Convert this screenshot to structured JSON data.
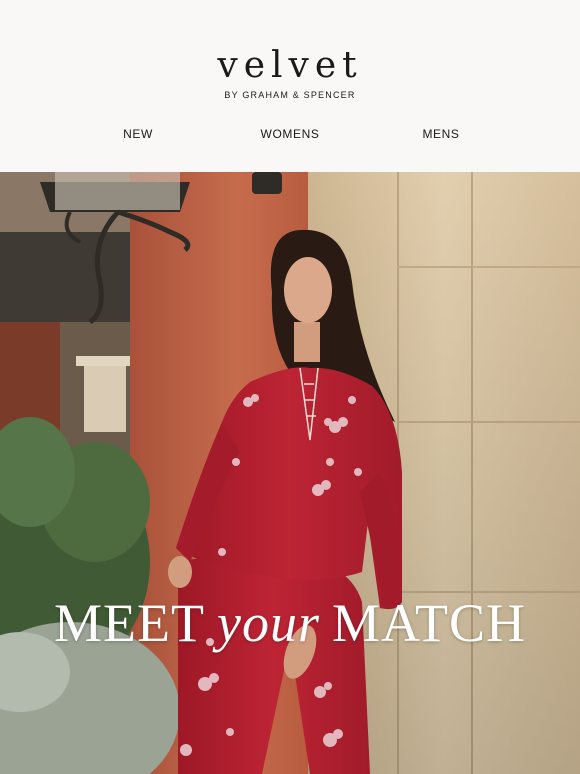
{
  "brand": {
    "logo_text": "velvet",
    "tagline": "BY GRAHAM & SPENCER"
  },
  "nav": {
    "items": [
      {
        "label": "NEW"
      },
      {
        "label": "WOMENS"
      },
      {
        "label": "MENS"
      }
    ]
  },
  "hero": {
    "headline_part1": "MEET",
    "headline_part2": "your",
    "headline_part3": "MATCH",
    "image_alt": "model in red floral lace-up pajama set leaning against stone column"
  },
  "colors": {
    "background": "#f9f8f6",
    "text": "#1a1a1a",
    "garment_red": "#b51f2e",
    "wall_terracotta": "#c2674a",
    "stone": "#ddc8a6"
  }
}
